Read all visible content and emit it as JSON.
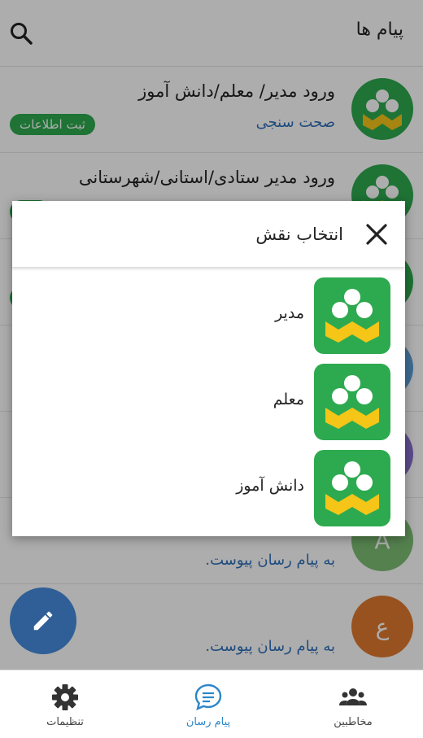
{
  "header": {
    "title": "پیام ها"
  },
  "list": {
    "rows": [
      {
        "title": "ورود مدیر/ معلم/دانش آموز",
        "subtitle": "صحت سنجی",
        "badge": "ثبت اطلاعات"
      },
      {
        "title": "ورود مدیر ستادی/استانی/شهرستانی",
        "subtitle": "",
        "badge": ""
      },
      {
        "title": "",
        "subtitle": "",
        "badge": ""
      },
      {
        "title": "",
        "subtitle": "",
        "badge": ""
      },
      {
        "title": "",
        "subtitle": "",
        "badge": ""
      },
      {
        "title": "",
        "subtitle": "به پیام رسان پیوست.",
        "badge": "",
        "avatar_letter": "A",
        "avatar_color": "#7cbf73"
      },
      {
        "title": "",
        "subtitle": "به پیام رسان پیوست.",
        "badge": "",
        "avatar_letter": "ع",
        "avatar_color": "#e0792e"
      }
    ]
  },
  "dialog": {
    "title": "انتخاب نقش",
    "roles": [
      {
        "label": "مدیر"
      },
      {
        "label": "معلم"
      },
      {
        "label": "دانش آموز"
      }
    ]
  },
  "bottom_nav": {
    "items": [
      {
        "label": "مخاطبین",
        "icon": "contacts-icon"
      },
      {
        "label": "پیام رسان",
        "icon": "chat-icon"
      },
      {
        "label": "تنظیمات",
        "icon": "gear-icon"
      }
    ],
    "active_index": 1
  },
  "colors": {
    "brand_green": "#2daa4f",
    "brand_yellow": "#f5c518",
    "link_blue": "#2f6fb8",
    "active_nav": "#2b86c8",
    "fab": "#2f5f96"
  }
}
